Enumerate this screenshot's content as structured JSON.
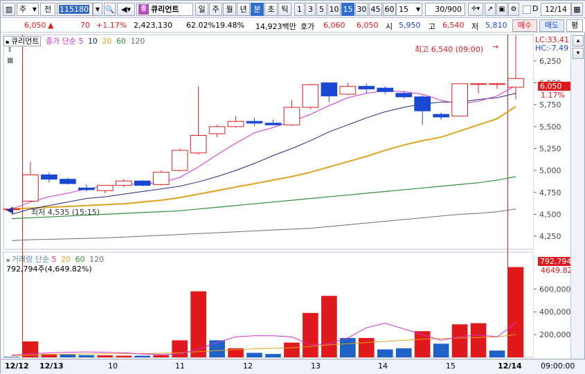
{
  "toolbar": {
    "market": "주",
    "chart_type": "전",
    "code": "115180",
    "badge": "종",
    "name": "큐리언트",
    "periods": [
      "일",
      "주",
      "월",
      "년",
      "분",
      "초",
      "틱",
      "1",
      "3",
      "5",
      "10",
      "15",
      "30",
      "45",
      "60"
    ],
    "active_periods": [
      "분",
      "15"
    ],
    "interval_value": "15",
    "count": "30/900",
    "checkbox_label": "D",
    "date": "12/14"
  },
  "quote": {
    "price": "6,050",
    "arrow": "▲",
    "change": "70",
    "change_pct": "+1.17%",
    "volume": "2,423,130",
    "vol_ratio": "62.02%",
    "turnover": "19.48%",
    "amount": "14,923백만",
    "hoga_label": "호가",
    "ask": "6,060",
    "bid": "6,050",
    "open_label": "시",
    "open": "5,950",
    "high_label": "고",
    "high": "6,540",
    "low_label": "저",
    "low": "5,810",
    "buy_btn": "매수",
    "sell_btn": "매도",
    "extra_btn": "평"
  },
  "chart_legend": {
    "stock_name": "큐리언트",
    "ma_label": "종가 단순",
    "ma_periods": [
      "5",
      "10",
      "20",
      "60",
      "120"
    ],
    "ma_colors": [
      "#d42fd0",
      "#1b2c7a",
      "#e0a21a",
      "#2f8f3a",
      "#6b6b6b"
    ],
    "lc": "LC:33.41",
    "hc": "HC:-7.49",
    "high_note": "최고 6,540 (09:00)",
    "low_note": "최저 4,535 (15:15)",
    "current_price_tag": "6,050",
    "current_pct_tag": "1.17%"
  },
  "volume_legend": {
    "title": "거래량 단순",
    "ma_periods": [
      "5",
      "20",
      "60",
      "120"
    ],
    "summary": "792,794주(4,649.82%)",
    "current_tag": "792,794",
    "current_pct": "4649.82%"
  },
  "x_labels": [
    "12/12",
    "12/13",
    "10",
    "11",
    "12",
    "13",
    "14",
    "15",
    "12/14",
    "09:00:00"
  ],
  "chart_data": [
    {
      "type": "candlestick",
      "title": "큐리언트",
      "ylim": [
        4100,
        6550
      ],
      "y_ticks": [
        4250,
        4500,
        4750,
        5000,
        5250,
        5500,
        5750,
        6000,
        6250
      ],
      "candles": [
        {
          "o": 4560,
          "h": 4580,
          "l": 4535,
          "c": 4560
        },
        {
          "o": 4650,
          "h": 5100,
          "l": 4650,
          "c": 4950
        },
        {
          "o": 4950,
          "h": 4980,
          "l": 4860,
          "c": 4900
        },
        {
          "o": 4900,
          "h": 4920,
          "l": 4840,
          "c": 4850
        },
        {
          "o": 4800,
          "h": 4840,
          "l": 4760,
          "c": 4780
        },
        {
          "o": 4770,
          "h": 4830,
          "l": 4740,
          "c": 4830
        },
        {
          "o": 4830,
          "h": 4900,
          "l": 4810,
          "c": 4880
        },
        {
          "o": 4880,
          "h": 4890,
          "l": 4820,
          "c": 4830
        },
        {
          "o": 4840,
          "h": 5000,
          "l": 4830,
          "c": 4980
        },
        {
          "o": 5000,
          "h": 5250,
          "l": 4990,
          "c": 5230
        },
        {
          "o": 5200,
          "h": 5960,
          "l": 5180,
          "c": 5400
        },
        {
          "o": 5420,
          "h": 5520,
          "l": 5380,
          "c": 5500
        },
        {
          "o": 5500,
          "h": 5620,
          "l": 5490,
          "c": 5560
        },
        {
          "o": 5560,
          "h": 5600,
          "l": 5510,
          "c": 5540
        },
        {
          "o": 5540,
          "h": 5580,
          "l": 5520,
          "c": 5520
        },
        {
          "o": 5520,
          "h": 5800,
          "l": 5510,
          "c": 5720
        },
        {
          "o": 5720,
          "h": 5990,
          "l": 5700,
          "c": 5980
        },
        {
          "o": 6000,
          "h": 6000,
          "l": 5780,
          "c": 5850
        },
        {
          "o": 5870,
          "h": 6000,
          "l": 5860,
          "c": 5960
        },
        {
          "o": 5960,
          "h": 5990,
          "l": 5880,
          "c": 5930
        },
        {
          "o": 5940,
          "h": 5960,
          "l": 5870,
          "c": 5900
        },
        {
          "o": 5880,
          "h": 5900,
          "l": 5820,
          "c": 5840
        },
        {
          "o": 5840,
          "h": 5860,
          "l": 5520,
          "c": 5680
        },
        {
          "o": 5640,
          "h": 5660,
          "l": 5580,
          "c": 5610
        },
        {
          "o": 5620,
          "h": 5990,
          "l": 5620,
          "c": 5990
        },
        {
          "o": 5990,
          "h": 5990,
          "l": 5880,
          "c": 5990
        },
        {
          "o": 5990,
          "h": 6000,
          "l": 5930,
          "c": 5990
        },
        {
          "o": 5950,
          "h": 6540,
          "l": 5810,
          "c": 6050
        }
      ],
      "ma5": [
        4560,
        4640,
        4700,
        4740,
        4790,
        4820,
        4840,
        4850,
        4860,
        4920,
        5040,
        5180,
        5310,
        5430,
        5490,
        5560,
        5640,
        5740,
        5830,
        5880,
        5910,
        5900,
        5870,
        5800,
        5760,
        5790,
        5850,
        5970
      ],
      "ma10": [
        4500,
        4560,
        4600,
        4640,
        4680,
        4700,
        4730,
        4760,
        4790,
        4820,
        4870,
        4930,
        5000,
        5080,
        5170,
        5250,
        5340,
        5440,
        5520,
        5600,
        5670,
        5720,
        5760,
        5780,
        5780,
        5810,
        5830,
        5880
      ],
      "ma20": [
        4560,
        4570,
        4580,
        4590,
        4600,
        4610,
        4620,
        4640,
        4660,
        4690,
        4730,
        4770,
        4810,
        4850,
        4890,
        4930,
        4980,
        5040,
        5100,
        5160,
        5230,
        5290,
        5340,
        5380,
        5450,
        5520,
        5590,
        5730
      ],
      "ma60": [
        4450,
        4460,
        4470,
        4480,
        4490,
        4500,
        4510,
        4520,
        4530,
        4540,
        4560,
        4580,
        4600,
        4620,
        4640,
        4660,
        4680,
        4700,
        4720,
        4740,
        4760,
        4780,
        4800,
        4820,
        4840,
        4860,
        4890,
        4930
      ],
      "ma120": [
        4200,
        4210,
        4215,
        4220,
        4225,
        4230,
        4240,
        4250,
        4260,
        4270,
        4280,
        4290,
        4300,
        4310,
        4320,
        4330,
        4340,
        4360,
        4380,
        4400,
        4420,
        4440,
        4460,
        4480,
        4500,
        4510,
        4530,
        4560
      ]
    },
    {
      "type": "bar",
      "title": "거래량",
      "ylim": [
        0,
        900000
      ],
      "y_ticks": [
        200000,
        400000,
        600000
      ],
      "values": [
        5000,
        140000,
        30000,
        25000,
        20000,
        18000,
        15000,
        15000,
        20000,
        150000,
        580000,
        150000,
        80000,
        40000,
        30000,
        130000,
        390000,
        540000,
        170000,
        170000,
        70000,
        80000,
        230000,
        120000,
        290000,
        300000,
        60000,
        792794
      ],
      "up": [
        false,
        true,
        true,
        false,
        false,
        true,
        true,
        false,
        true,
        true,
        true,
        false,
        true,
        false,
        false,
        true,
        true,
        true,
        false,
        true,
        false,
        false,
        true,
        false,
        true,
        true,
        false,
        true
      ],
      "ma5": [
        20000,
        30000,
        40000,
        45000,
        48000,
        45000,
        40000,
        30000,
        25000,
        30000,
        70000,
        130000,
        180000,
        190000,
        190000,
        180000,
        110000,
        120000,
        170000,
        260000,
        300000,
        250000,
        200000,
        150000,
        180000,
        200000,
        180000,
        300000
      ],
      "ma20": [
        15000,
        20000,
        25000,
        28000,
        30000,
        32000,
        33000,
        34000,
        36000,
        40000,
        50000,
        60000,
        68000,
        75000,
        80000,
        85000,
        95000,
        110000,
        120000,
        130000,
        140000,
        150000,
        160000,
        165000,
        170000,
        175000,
        180000,
        200000
      ]
    }
  ]
}
